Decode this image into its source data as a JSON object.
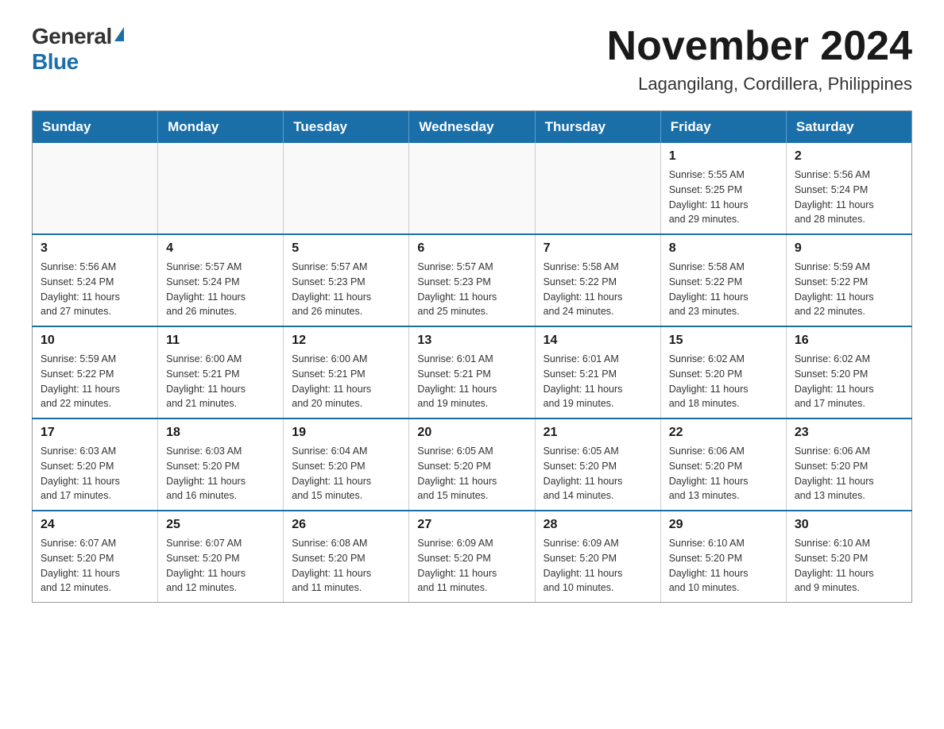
{
  "logo": {
    "general": "General",
    "blue": "Blue"
  },
  "header": {
    "month": "November 2024",
    "location": "Lagangilang, Cordillera, Philippines"
  },
  "weekdays": [
    "Sunday",
    "Monday",
    "Tuesday",
    "Wednesday",
    "Thursday",
    "Friday",
    "Saturday"
  ],
  "weeks": [
    [
      {
        "day": "",
        "info": ""
      },
      {
        "day": "",
        "info": ""
      },
      {
        "day": "",
        "info": ""
      },
      {
        "day": "",
        "info": ""
      },
      {
        "day": "",
        "info": ""
      },
      {
        "day": "1",
        "info": "Sunrise: 5:55 AM\nSunset: 5:25 PM\nDaylight: 11 hours\nand 29 minutes."
      },
      {
        "day": "2",
        "info": "Sunrise: 5:56 AM\nSunset: 5:24 PM\nDaylight: 11 hours\nand 28 minutes."
      }
    ],
    [
      {
        "day": "3",
        "info": "Sunrise: 5:56 AM\nSunset: 5:24 PM\nDaylight: 11 hours\nand 27 minutes."
      },
      {
        "day": "4",
        "info": "Sunrise: 5:57 AM\nSunset: 5:24 PM\nDaylight: 11 hours\nand 26 minutes."
      },
      {
        "day": "5",
        "info": "Sunrise: 5:57 AM\nSunset: 5:23 PM\nDaylight: 11 hours\nand 26 minutes."
      },
      {
        "day": "6",
        "info": "Sunrise: 5:57 AM\nSunset: 5:23 PM\nDaylight: 11 hours\nand 25 minutes."
      },
      {
        "day": "7",
        "info": "Sunrise: 5:58 AM\nSunset: 5:22 PM\nDaylight: 11 hours\nand 24 minutes."
      },
      {
        "day": "8",
        "info": "Sunrise: 5:58 AM\nSunset: 5:22 PM\nDaylight: 11 hours\nand 23 minutes."
      },
      {
        "day": "9",
        "info": "Sunrise: 5:59 AM\nSunset: 5:22 PM\nDaylight: 11 hours\nand 22 minutes."
      }
    ],
    [
      {
        "day": "10",
        "info": "Sunrise: 5:59 AM\nSunset: 5:22 PM\nDaylight: 11 hours\nand 22 minutes."
      },
      {
        "day": "11",
        "info": "Sunrise: 6:00 AM\nSunset: 5:21 PM\nDaylight: 11 hours\nand 21 minutes."
      },
      {
        "day": "12",
        "info": "Sunrise: 6:00 AM\nSunset: 5:21 PM\nDaylight: 11 hours\nand 20 minutes."
      },
      {
        "day": "13",
        "info": "Sunrise: 6:01 AM\nSunset: 5:21 PM\nDaylight: 11 hours\nand 19 minutes."
      },
      {
        "day": "14",
        "info": "Sunrise: 6:01 AM\nSunset: 5:21 PM\nDaylight: 11 hours\nand 19 minutes."
      },
      {
        "day": "15",
        "info": "Sunrise: 6:02 AM\nSunset: 5:20 PM\nDaylight: 11 hours\nand 18 minutes."
      },
      {
        "day": "16",
        "info": "Sunrise: 6:02 AM\nSunset: 5:20 PM\nDaylight: 11 hours\nand 17 minutes."
      }
    ],
    [
      {
        "day": "17",
        "info": "Sunrise: 6:03 AM\nSunset: 5:20 PM\nDaylight: 11 hours\nand 17 minutes."
      },
      {
        "day": "18",
        "info": "Sunrise: 6:03 AM\nSunset: 5:20 PM\nDaylight: 11 hours\nand 16 minutes."
      },
      {
        "day": "19",
        "info": "Sunrise: 6:04 AM\nSunset: 5:20 PM\nDaylight: 11 hours\nand 15 minutes."
      },
      {
        "day": "20",
        "info": "Sunrise: 6:05 AM\nSunset: 5:20 PM\nDaylight: 11 hours\nand 15 minutes."
      },
      {
        "day": "21",
        "info": "Sunrise: 6:05 AM\nSunset: 5:20 PM\nDaylight: 11 hours\nand 14 minutes."
      },
      {
        "day": "22",
        "info": "Sunrise: 6:06 AM\nSunset: 5:20 PM\nDaylight: 11 hours\nand 13 minutes."
      },
      {
        "day": "23",
        "info": "Sunrise: 6:06 AM\nSunset: 5:20 PM\nDaylight: 11 hours\nand 13 minutes."
      }
    ],
    [
      {
        "day": "24",
        "info": "Sunrise: 6:07 AM\nSunset: 5:20 PM\nDaylight: 11 hours\nand 12 minutes."
      },
      {
        "day": "25",
        "info": "Sunrise: 6:07 AM\nSunset: 5:20 PM\nDaylight: 11 hours\nand 12 minutes."
      },
      {
        "day": "26",
        "info": "Sunrise: 6:08 AM\nSunset: 5:20 PM\nDaylight: 11 hours\nand 11 minutes."
      },
      {
        "day": "27",
        "info": "Sunrise: 6:09 AM\nSunset: 5:20 PM\nDaylight: 11 hours\nand 11 minutes."
      },
      {
        "day": "28",
        "info": "Sunrise: 6:09 AM\nSunset: 5:20 PM\nDaylight: 11 hours\nand 10 minutes."
      },
      {
        "day": "29",
        "info": "Sunrise: 6:10 AM\nSunset: 5:20 PM\nDaylight: 11 hours\nand 10 minutes."
      },
      {
        "day": "30",
        "info": "Sunrise: 6:10 AM\nSunset: 5:20 PM\nDaylight: 11 hours\nand 9 minutes."
      }
    ]
  ]
}
